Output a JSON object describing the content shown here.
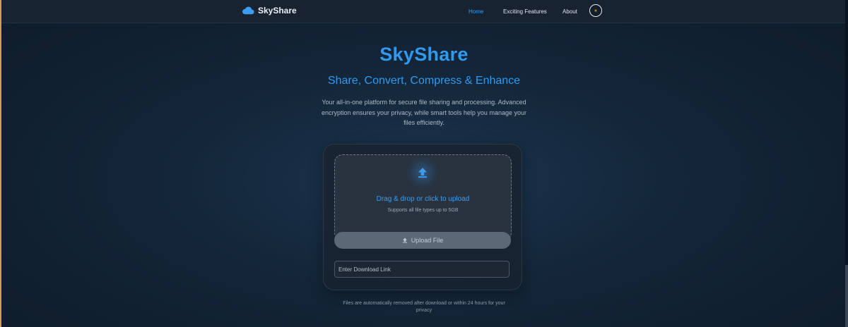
{
  "navbar": {
    "brand": "SkyShare",
    "links": [
      {
        "label": "Home",
        "active": true
      },
      {
        "label": "Exciting Features",
        "active": false
      },
      {
        "label": "About",
        "active": false
      }
    ],
    "theme_icon": "gear-icon"
  },
  "hero": {
    "title": "SkyShare",
    "subtitle": "Share, Convert, Compress & Enhance",
    "description": "Your all-in-one platform for secure file sharing and processing. Advanced encryption ensures your privacy, while smart tools help you manage your files efficiently."
  },
  "upload_card": {
    "dropzone_icon": "upload-arrow-icon",
    "dropzone_title": "Drag & drop or click to upload",
    "dropzone_hint": "Supports all file types up to 5GB",
    "upload_button_label": "Upload File",
    "download_link_placeholder": "Enter Download Link"
  },
  "footnote": "Files are automatically removed after download or within 24 hours for your privacy",
  "colors": {
    "accent": "#2f9af0",
    "background": "#132537",
    "navbar": "#172331",
    "button_disabled": "#5b6875"
  }
}
